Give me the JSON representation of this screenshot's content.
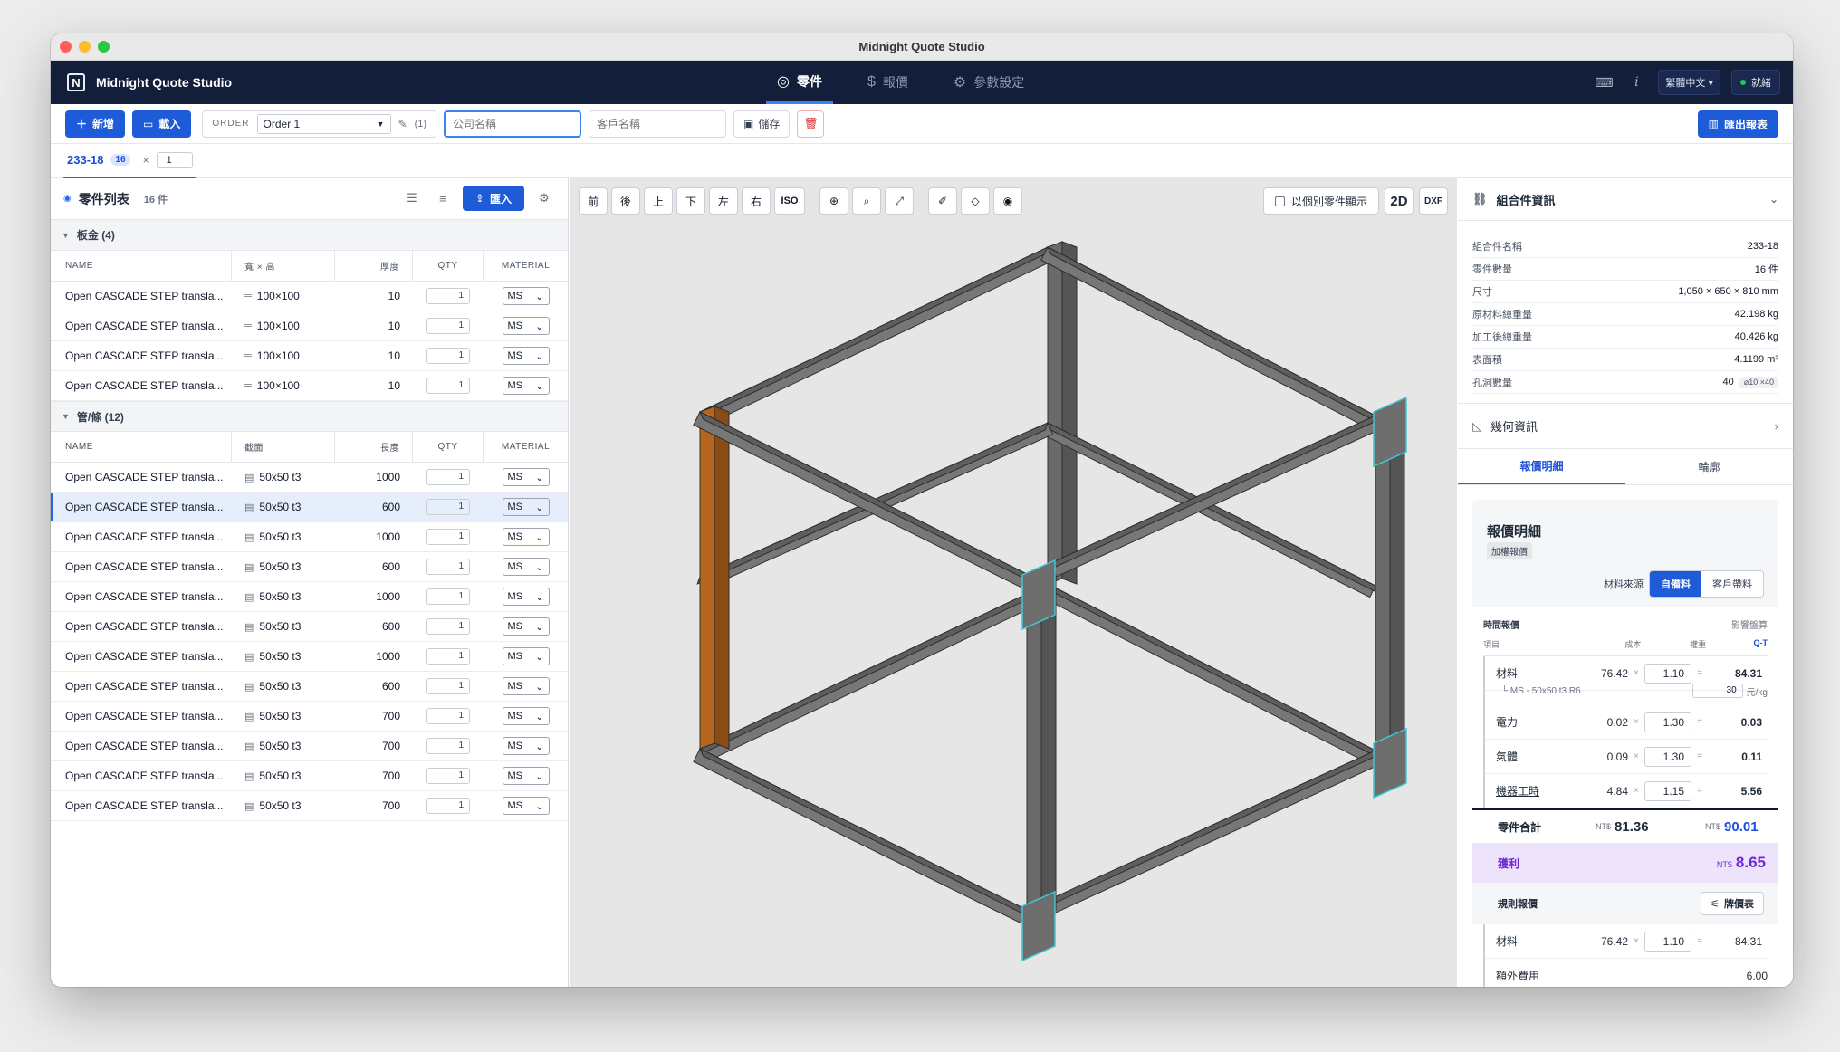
{
  "window": {
    "title": "Midnight Quote Studio"
  },
  "app": {
    "brand": "Midnight Quote Studio",
    "nav": [
      {
        "label": "零件",
        "icon": "target-icon",
        "active": true
      },
      {
        "label": "報價",
        "icon": "dollar-icon",
        "active": false
      },
      {
        "label": "參數設定",
        "icon": "gear-icon",
        "active": false
      }
    ],
    "language": "繁體中文",
    "status": "就緒"
  },
  "toolbar": {
    "new_label": "新增",
    "load_label": "載入",
    "order_label": "ORDER",
    "order_value": "Order 1",
    "order_count": "(1)",
    "company_placeholder": "公司名稱",
    "customer_placeholder": "客戶名稱",
    "save_label": "儲存",
    "export_label": "匯出報表"
  },
  "assembly_tab": {
    "name": "233-18",
    "badge": "16",
    "multiplier": "×",
    "qty": "1"
  },
  "parts": {
    "title": "零件列表",
    "count": "16 件",
    "import_label": "匯入",
    "sheet_group": {
      "title": "板金 (4)",
      "columns": [
        "NAME",
        "寬 × 高",
        "厚度",
        "QTY",
        "MATERIAL"
      ],
      "rows": [
        {
          "name": "Open CASCADE STEP transla...",
          "dim": "100×100",
          "val": "10",
          "qty": "1",
          "mat": "MS"
        },
        {
          "name": "Open CASCADE STEP transla...",
          "dim": "100×100",
          "val": "10",
          "qty": "1",
          "mat": "MS"
        },
        {
          "name": "Open CASCADE STEP transla...",
          "dim": "100×100",
          "val": "10",
          "qty": "1",
          "mat": "MS"
        },
        {
          "name": "Open CASCADE STEP transla...",
          "dim": "100×100",
          "val": "10",
          "qty": "1",
          "mat": "MS"
        }
      ]
    },
    "tube_group": {
      "title": "管/條 (12)",
      "columns": [
        "NAME",
        "截面",
        "長度",
        "QTY",
        "MATERIAL"
      ],
      "rows": [
        {
          "name": "Open CASCADE STEP transla...",
          "dim": "50x50 t3",
          "val": "1000",
          "qty": "1",
          "mat": "MS"
        },
        {
          "name": "Open CASCADE STEP transla...",
          "dim": "50x50 t3",
          "val": "600",
          "qty": "1",
          "mat": "MS"
        },
        {
          "name": "Open CASCADE STEP transla...",
          "dim": "50x50 t3",
          "val": "1000",
          "qty": "1",
          "mat": "MS"
        },
        {
          "name": "Open CASCADE STEP transla...",
          "dim": "50x50 t3",
          "val": "600",
          "qty": "1",
          "mat": "MS"
        },
        {
          "name": "Open CASCADE STEP transla...",
          "dim": "50x50 t3",
          "val": "1000",
          "qty": "1",
          "mat": "MS"
        },
        {
          "name": "Open CASCADE STEP transla...",
          "dim": "50x50 t3",
          "val": "600",
          "qty": "1",
          "mat": "MS"
        },
        {
          "name": "Open CASCADE STEP transla...",
          "dim": "50x50 t3",
          "val": "1000",
          "qty": "1",
          "mat": "MS"
        },
        {
          "name": "Open CASCADE STEP transla...",
          "dim": "50x50 t3",
          "val": "600",
          "qty": "1",
          "mat": "MS"
        },
        {
          "name": "Open CASCADE STEP transla...",
          "dim": "50x50 t3",
          "val": "700",
          "qty": "1",
          "mat": "MS"
        },
        {
          "name": "Open CASCADE STEP transla...",
          "dim": "50x50 t3",
          "val": "700",
          "qty": "1",
          "mat": "MS"
        },
        {
          "name": "Open CASCADE STEP transla...",
          "dim": "50x50 t3",
          "val": "700",
          "qty": "1",
          "mat": "MS"
        },
        {
          "name": "Open CASCADE STEP transla...",
          "dim": "50x50 t3",
          "val": "700",
          "qty": "1",
          "mat": "MS"
        }
      ]
    }
  },
  "viewer": {
    "views": [
      "前",
      "後",
      "上",
      "下",
      "左",
      "右",
      "ISO"
    ],
    "toggle_label": "以個別零件顯示",
    "mode_2d": "2D",
    "mode_dxf": "DXF",
    "colors": {
      "frame": "#6b6b6b",
      "highlight": "#b5651d",
      "edge": "#3ec9d6"
    }
  },
  "assembly_info": {
    "title": "組合件資訊",
    "rows": [
      {
        "k": "組合件名稱",
        "v": "233-18"
      },
      {
        "k": "零件數量",
        "v": "16 件"
      },
      {
        "k": "尺寸",
        "v": "1,050 × 650 × 810 mm"
      },
      {
        "k": "原材料總重量",
        "v": "42.198 kg"
      },
      {
        "k": "加工後總重量",
        "v": "40.426 kg"
      },
      {
        "k": "表面積",
        "v": "4.1199 m²"
      },
      {
        "k": "孔洞數量",
        "v": "40",
        "chip": "⌀10 ×40"
      }
    ]
  },
  "geometry": {
    "title": "幾何資訊"
  },
  "quote": {
    "tabs": [
      "報價明細",
      "輪廓"
    ],
    "title": "報價明細",
    "subtitle": "加權報價",
    "source_label": "材料來源",
    "source_options": [
      "自備料",
      "客戶帶料"
    ],
    "time_label": "時間報價",
    "impact_label": "影響盤算",
    "col_item": "項目",
    "col_cost": "成本",
    "col_weight": "權重",
    "col_qt": "Q-T",
    "lines": [
      {
        "name": "材料",
        "cost": "76.42",
        "weight": "1.10",
        "result": "84.31"
      },
      {
        "name": "電力",
        "cost": "0.02",
        "weight": "1.30",
        "result": "0.03"
      },
      {
        "name": "氣體",
        "cost": "0.09",
        "weight": "1.30",
        "result": "0.11"
      },
      {
        "name": "機器工時",
        "cost": "4.84",
        "weight": "1.15",
        "result": "5.56"
      }
    ],
    "material_sub": "└ MS - 50x50 t3 R6",
    "unit_price": "30",
    "unit_label": "元/kg",
    "total_label": "零件合計",
    "currency": "NT$",
    "total_cost": "81.36",
    "total_weighted": "90.01",
    "profit_label": "獲利",
    "profit": "8.65",
    "rule_label": "規則報價",
    "rule_button": "牌價表",
    "rule_lines": [
      {
        "name": "材料",
        "cost": "76.42",
        "weight": "1.10",
        "result": "84.31"
      },
      {
        "name": "額外費用",
        "result": "6.00"
      }
    ]
  }
}
